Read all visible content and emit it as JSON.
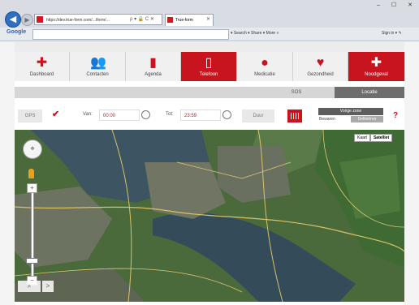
{
  "browser": {
    "url": "https://dev.true-form.com/.../form/...",
    "tab_title": "True-form",
    "address_icons": "ρ ▾ 🔒 C ✕",
    "window_buttons": "– ☐ ✕",
    "google_label": "Google",
    "toolbar_items": "▾ Search ▾   Share ▾   More »",
    "toolbar_right": "Sign in ▾ ✎"
  },
  "nav": {
    "items": [
      {
        "label": "Dashboard",
        "icon": "plus-cross-icon"
      },
      {
        "label": "Contacten",
        "icon": "contacts-icon"
      },
      {
        "label": "Agenda",
        "icon": "agenda-icon"
      },
      {
        "label": "Telefoon",
        "icon": "phone-icon"
      },
      {
        "label": "Medicatie",
        "icon": "pills-icon"
      },
      {
        "label": "Gezondheid",
        "icon": "heart-icon"
      },
      {
        "label": "Noodgeval",
        "icon": "emergency-icon"
      }
    ],
    "active_index": 3,
    "active_color": "#c8141f"
  },
  "subnav": {
    "sos_label": "SOS",
    "locatie_label": "Locatie"
  },
  "filter": {
    "gps_label": "GPS",
    "gps_checked": true,
    "van_label": "Van:",
    "van_value": "00:00",
    "tot_label": "Tot:",
    "tot_value": "23:59",
    "duur_label": "Duur",
    "vorige_zone_label": "Vorige zone",
    "bewaren_label": "Bewaren",
    "definieren_label": "Definiëren",
    "help_label": "?"
  },
  "map": {
    "type_map_label": "Kaart",
    "type_satellite_label": "Satelliet",
    "active_type": "satellite",
    "zoom_plus": "+",
    "zoom_minus": "−",
    "search_label": "⌕",
    "next_label": ">"
  }
}
